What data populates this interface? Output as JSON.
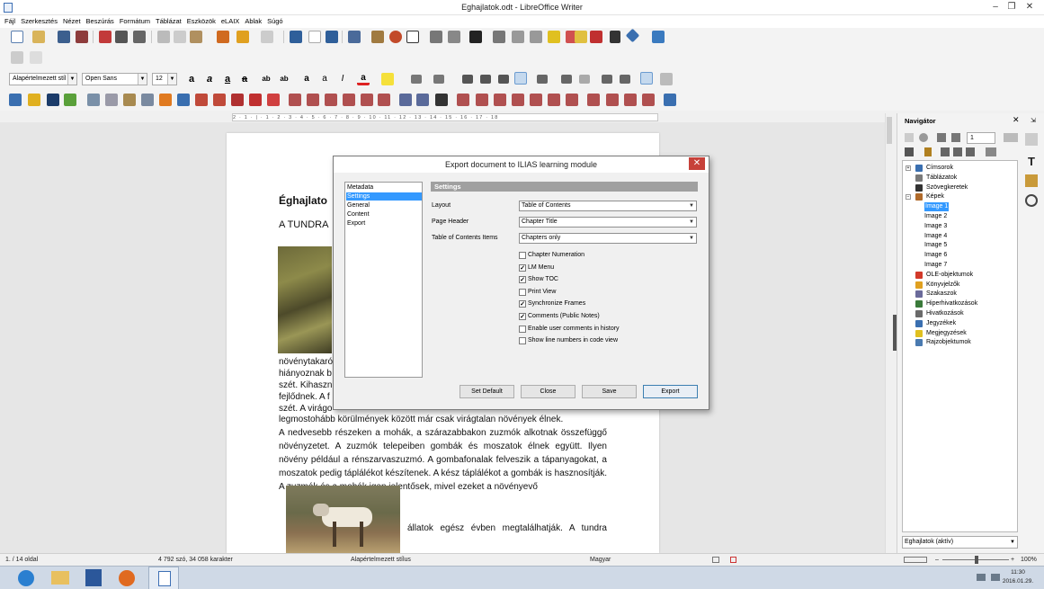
{
  "window": {
    "title": "Eghajlatok.odt - LibreOffice Writer"
  },
  "menu": [
    "Fájl",
    "Szerkesztés",
    "Nézet",
    "Beszúrás",
    "Formátum",
    "Táblázat",
    "Eszközök",
    "eLAIX",
    "Ablak",
    "Súgó"
  ],
  "format_toolbar": {
    "paragraph_style": "Alapértelmezett stíl",
    "font_name": "Open Sans",
    "font_size": "12"
  },
  "ruler": {
    "marks": "2 · 1 · | · 1 · 2 · 3 · 4 · 5 · 6 · 7 · 8 · 9 · 10 · 11 · 12 · 13 · 14 · 15 · 16 · 17 · 18"
  },
  "document": {
    "heading": "Éghajlato",
    "subheading": "A TUNDRA",
    "partial_lines": [
      "növénytakaró",
      "hiányoznak b",
      "szét. Kihaszn",
      "fejlődnek. A f",
      "szét. A virágo"
    ],
    "line_full_1": "legmostohább körülmények között már csak virágtalan növények élnek.",
    "paragraph_2": "A nedvesebb részeken a mohák, a szárazabbakon zuzmók alkotnak összefüggő növényzetet. A zuzmók telepeiben gombák és moszatok élnek együtt. Ilyen növény például a rénszarvaszuzmó. A gombafonalak felveszik a tápanyagokat, a moszatok pedig táplálékot készítenek. A kész táplálékot a gombák is hasznosítják. A zuzmók és a mohák igen jelentősek, mivel ezeket a növényevő",
    "line_after_image": "állatok egész évben megtalálhatják. A tundra"
  },
  "dialog": {
    "title": "Export document to ILIAS learning module",
    "close_glyph": "✕",
    "nav_items": [
      "Metadata",
      "Settings",
      "General",
      "Content",
      "Export"
    ],
    "selected_index": 1,
    "section_title": "Settings",
    "fields": [
      {
        "label": "Layout",
        "value": "Table of Contents"
      },
      {
        "label": "Page Header",
        "value": "Chapter Title"
      },
      {
        "label": "Table of Contents Items",
        "value": "Chapters only"
      }
    ],
    "checkboxes": [
      {
        "label": "Chapter Numeration",
        "checked": false
      },
      {
        "label": "LM Menu",
        "checked": true
      },
      {
        "label": "Show TOC",
        "checked": true
      },
      {
        "label": "Print View",
        "checked": false
      },
      {
        "label": "Synchronize Frames",
        "checked": true
      },
      {
        "label": "Comments (Public Notes)",
        "checked": true
      },
      {
        "label": "Enable user comments in history",
        "checked": false
      },
      {
        "label": "Show line numbers in code view",
        "checked": false
      }
    ],
    "buttons": {
      "set_default": "Set Default",
      "close": "Close",
      "save": "Save",
      "export": "Export"
    }
  },
  "navigator": {
    "title": "Navigátor",
    "page_number": "1",
    "items": [
      {
        "label": "Címsorok",
        "level": 0,
        "color": "#3a6fb0"
      },
      {
        "label": "Táblázatok",
        "level": 0,
        "color": "#7a7a7a"
      },
      {
        "label": "Szövegkeretek",
        "level": 0,
        "color": "#333333"
      },
      {
        "label": "Képek",
        "level": 0,
        "color": "#b06a2a"
      },
      {
        "label": "Image 1",
        "level": 1,
        "selected": true
      },
      {
        "label": "Image 2",
        "level": 1
      },
      {
        "label": "Image 3",
        "level": 1
      },
      {
        "label": "Image 4",
        "level": 1
      },
      {
        "label": "Image 5",
        "level": 1
      },
      {
        "label": "Image 6",
        "level": 1
      },
      {
        "label": "Image 7",
        "level": 1
      },
      {
        "label": "OLE-objektumok",
        "level": 0,
        "color": "#d23a2a"
      },
      {
        "label": "Könyvjelzők",
        "level": 0,
        "color": "#e0a020"
      },
      {
        "label": "Szakaszok",
        "level": 0,
        "color": "#6a6a9a"
      },
      {
        "label": "Hiperhivatkozások",
        "level": 0,
        "color": "#3a7a3a"
      },
      {
        "label": "Hivatkozások",
        "level": 0,
        "color": "#6a6a6a"
      },
      {
        "label": "Jegyzékek",
        "level": 0,
        "color": "#3a6fb0"
      },
      {
        "label": "Megjegyzések",
        "level": 0,
        "color": "#e0c020"
      },
      {
        "label": "Rajzobjektumok",
        "level": 0,
        "color": "#4a7ab0"
      }
    ],
    "document_select": "Eghajlatok (aktív)"
  },
  "statusbar": {
    "page": "1. / 14 oldal",
    "words": "4 792 szó, 34 058 karakter",
    "style": "Alapértelmezett stílus",
    "language": "Magyar",
    "zoom": "100%"
  },
  "taskbar": {
    "time": "11:30",
    "date": "2016.01.29."
  }
}
